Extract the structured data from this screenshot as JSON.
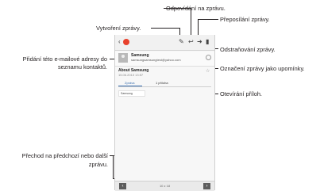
{
  "annotations": {
    "reply": "Odpovídání na zprávu.",
    "compose": "Vytvoření zprávy.",
    "forward": "Přeposílání zprávy.",
    "delete": "Odstraňování zprávy.",
    "add_contact_line1": "Přidání této e-mailové adresy do",
    "add_contact_line2": "seznamu kontaktů.",
    "flag": "Označení zprávy jako upomínky.",
    "attachments": "Otevírání příloh.",
    "nav_line1": "Přechod na předchozí nebo další",
    "nav_line2": "zprávu."
  },
  "email": {
    "sender_name": "Samsung",
    "sender_email": "samsungsamsungtest@yahoo.com",
    "subject": "About Samsung",
    "date": "15.06.2013 13:57",
    "tabs": [
      "Zpráva",
      "1 příloha"
    ],
    "body_snippet": "Samsung",
    "page_indicator": "10 z 18"
  },
  "icons": {
    "back": "back-arrow-icon",
    "app": "email-app-icon",
    "compose": "compose-icon",
    "reply": "reply-icon",
    "forward": "forward-icon",
    "delete": "trash-icon",
    "prev": "chevron-left-icon",
    "next": "chevron-right-icon"
  },
  "colors": {
    "app_icon": "#e8412c",
    "tab_active": "#3a6fb0",
    "nav_button": "#5d5d5d"
  }
}
